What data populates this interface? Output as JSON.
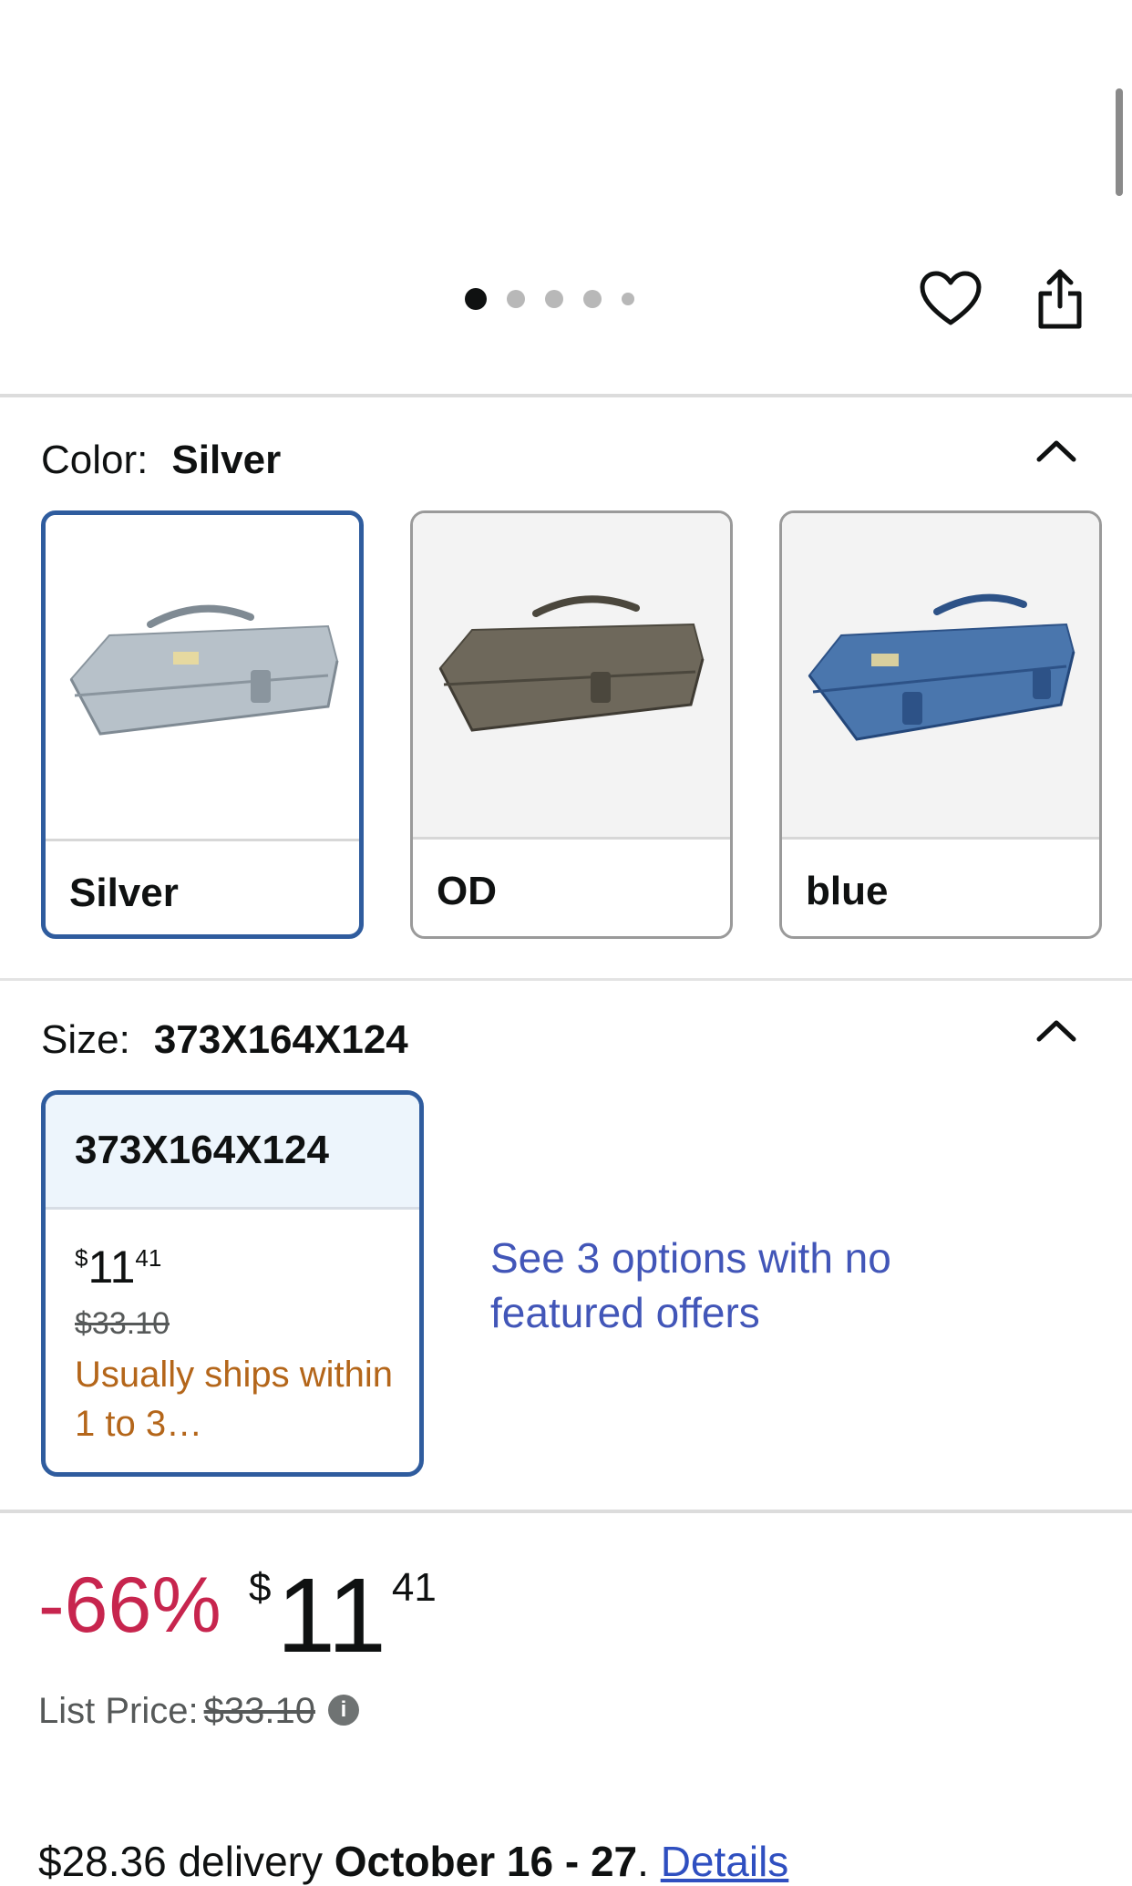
{
  "gallery": {
    "dot_count": 5,
    "active_dot": 1
  },
  "icons": {
    "favorite": "heart-icon",
    "share": "share-icon",
    "collapse": "chevron-up-icon",
    "info": "info-icon"
  },
  "color_section": {
    "label": "Color:",
    "selected_value": "Silver",
    "options": [
      {
        "name": "Silver",
        "selected": true,
        "swatch_color": "#a4afb8"
      },
      {
        "name": "OD",
        "selected": false,
        "swatch_color": "#5f5a4e"
      },
      {
        "name": "blue",
        "selected": false,
        "swatch_color": "#3f6aa0"
      }
    ]
  },
  "size_section": {
    "label": "Size:",
    "selected_value": "373X164X124",
    "card": {
      "title": "373X164X124",
      "price_symbol": "$",
      "price_whole": "11",
      "price_fraction": "41",
      "list_price": "$33.10",
      "shipping": "Usually ships within 1 to 3…"
    },
    "see_options_link": "See 3 options with no featured offers"
  },
  "price_block": {
    "discount": "-66%",
    "price_symbol": "$",
    "price_whole": "11",
    "price_fraction": "41",
    "list_price_label": "List Price:",
    "list_price_value": "$33.10",
    "info_glyph": "i"
  },
  "delivery": {
    "fee_text": "$28.36 delivery",
    "date": "October 16 - 27",
    "punct": ".",
    "details_link": "Details"
  },
  "colors": {
    "accent_border": "#2f5c9e",
    "discount": "#c7254e",
    "link": "#4256b8",
    "shipping_note": "#b4661a"
  }
}
